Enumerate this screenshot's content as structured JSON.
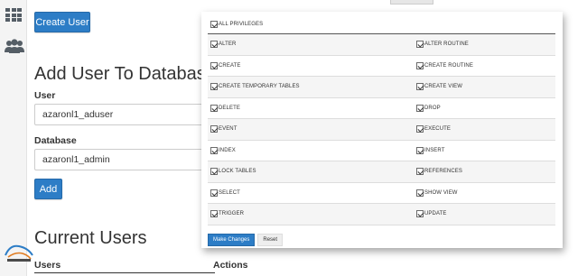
{
  "create_user_button": "Create User",
  "add_user_section": {
    "heading": "Add User To Database",
    "user_label": "User",
    "user_value": "azaronl1_aduser",
    "database_label": "Database",
    "database_value": "azaronl1_admin",
    "add_button": "Add"
  },
  "current_users": {
    "heading": "Current Users",
    "columns": [
      "Users",
      "Actions"
    ]
  },
  "privileges": {
    "all_label": "ALL PRIVILEGES",
    "rows": [
      {
        "left": "ALTER",
        "right": "ALTER ROUTINE"
      },
      {
        "left": "CREATE",
        "right": "CREATE ROUTINE"
      },
      {
        "left": "CREATE TEMPORARY TABLES",
        "right": "CREATE VIEW"
      },
      {
        "left": "DELETE",
        "right": "DROP"
      },
      {
        "left": "EVENT",
        "right": "EXECUTE"
      },
      {
        "left": "INDEX",
        "right": "INSERT"
      },
      {
        "left": "LOCK TABLES",
        "right": "REFERENCES"
      },
      {
        "left": "SELECT",
        "right": "SHOW VIEW"
      },
      {
        "left": "TRIGGER",
        "right": "UPDATE"
      }
    ],
    "make_changes_button": "Make Changes",
    "reset_button": "Reset"
  },
  "icons": {
    "rail_top": "grid-icon",
    "rail_users": "users-icon"
  },
  "colors": {
    "primary": "#2d7dc6",
    "rail_bg": "#f4f4f4",
    "text": "#333333"
  }
}
